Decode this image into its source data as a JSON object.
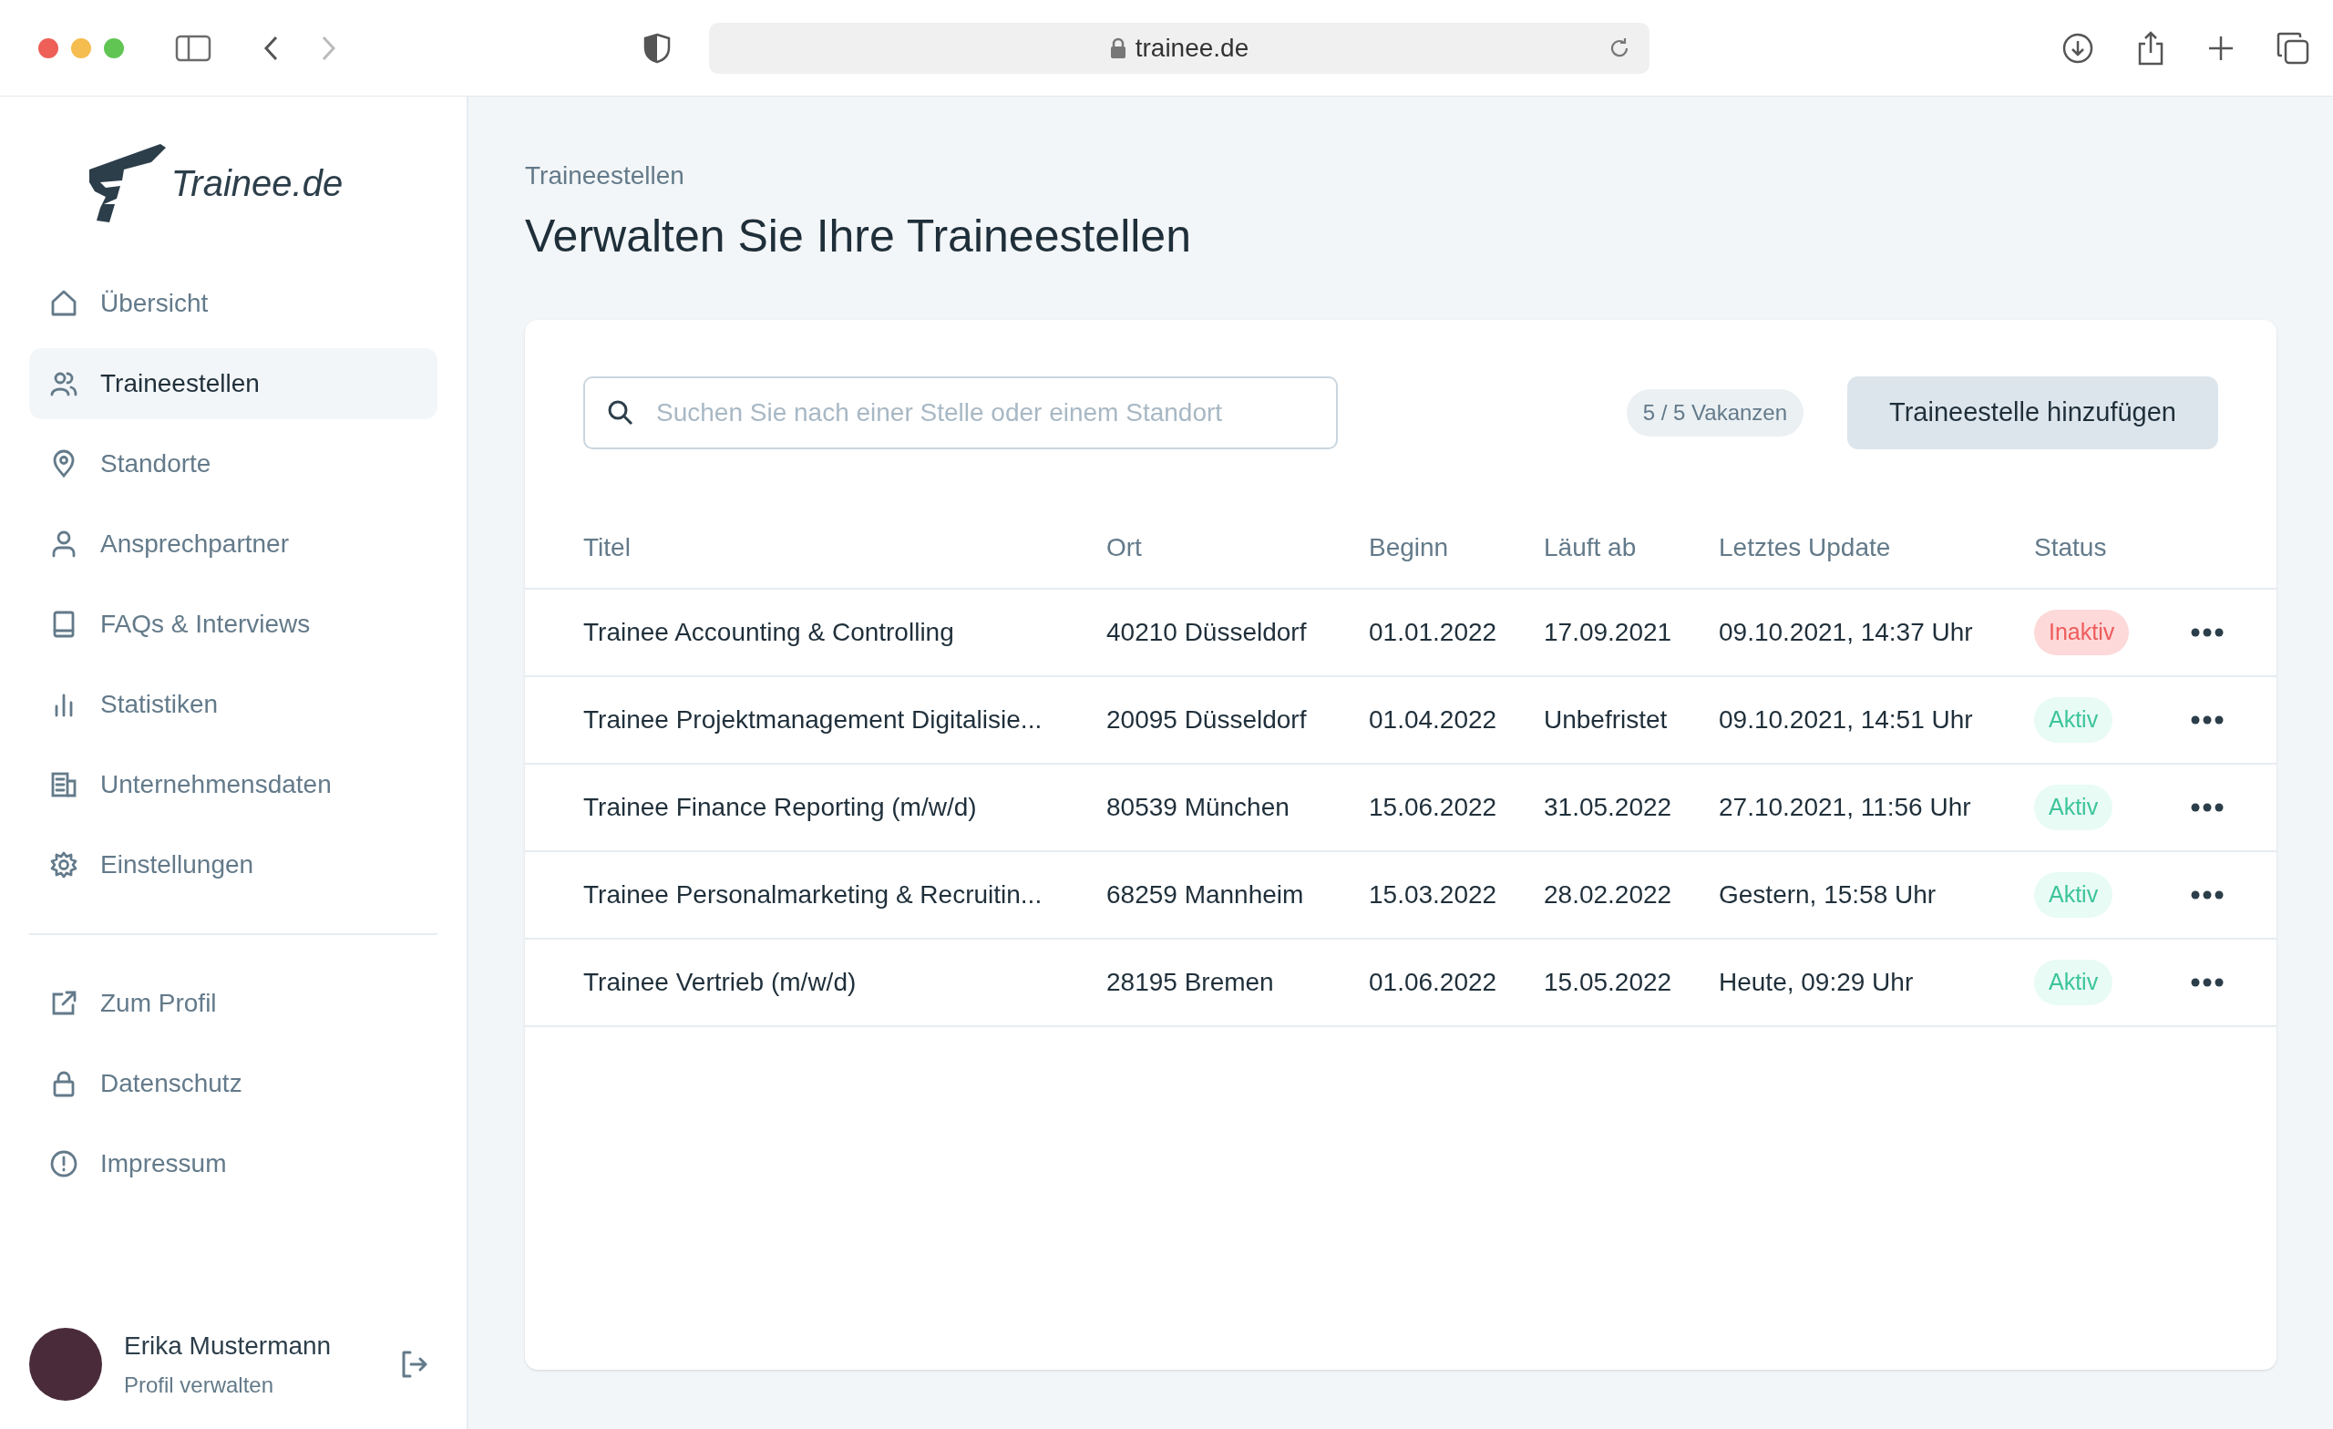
{
  "browser": {
    "url": "trainee.de"
  },
  "sidebar": {
    "logo": "**Trainee**.de",
    "items": [
      {
        "label": "Übersicht",
        "selected": false
      },
      {
        "label": "Traineestellen",
        "selected": true
      },
      {
        "label": "Standorte",
        "selected": false
      },
      {
        "label": "Ansprechpartner",
        "selected": false
      },
      {
        "label": "FAQs & Interviews",
        "selected": false
      },
      {
        "label": "Statistiken",
        "selected": false
      },
      {
        "label": "Unternehmensdaten",
        "selected": false
      },
      {
        "label": "Einstellungen",
        "selected": false
      }
    ],
    "secondary_items": [
      {
        "label": "Zum Profil"
      },
      {
        "label": "Datenschutz"
      },
      {
        "label": "Impressum"
      }
    ],
    "user": {
      "name": "Erika Mustermann",
      "subtitle": "Profil verwalten"
    }
  },
  "page": {
    "breadcrumb": "Traineestellen",
    "title": "Verwalten Sie Ihre Traineestellen"
  },
  "toolbar": {
    "search": {
      "placeholder": "Suchen Sie nach einer Stelle oder einem Standort"
    },
    "vacancies": "5 / 5 Vakanzen",
    "add_button": "Traineestelle hinzufügen"
  },
  "table": {
    "columns": [
      "Titel",
      "Ort",
      "Beginn",
      "Läuft ab",
      "Letztes Update",
      "Status"
    ],
    "rows": [
      {
        "cells": [
          "Trainee Accounting & Controlling",
          "40210 Düsseldorf",
          "01.01.2022",
          "17.09.2021",
          "09.10.2021, 14:37 Uhr"
        ],
        "status": {
          "label": "Inaktiv",
          "kind": "inactive"
        }
      },
      {
        "cells": [
          "Trainee Projektmanagement Digitalisie...",
          "20095 Düsseldorf",
          "01.04.2022",
          "Unbefristet",
          "09.10.2021, 14:51 Uhr"
        ],
        "status": {
          "label": "Aktiv",
          "kind": "active"
        }
      },
      {
        "cells": [
          "Trainee Finance Reporting (m/w/d)",
          "80539 München",
          "15.06.2022",
          "31.05.2022",
          "27.10.2021, 11:56 Uhr"
        ],
        "status": {
          "label": "Aktiv",
          "kind": "active"
        }
      },
      {
        "cells": [
          "Trainee Personalmarketing & Recruitin...",
          "68259 Mannheim",
          "15.03.2022",
          "28.02.2022",
          "Gestern, 15:58 Uhr"
        ],
        "status": {
          "label": "Aktiv",
          "kind": "active"
        }
      },
      {
        "cells": [
          "Trainee Vertrieb (m/w/d)",
          "28195 Bremen",
          "01.06.2022",
          "15.05.2022",
          "Heute, 09:29 Uhr"
        ],
        "status": {
          "label": "Aktiv",
          "kind": "active"
        }
      }
    ]
  }
}
